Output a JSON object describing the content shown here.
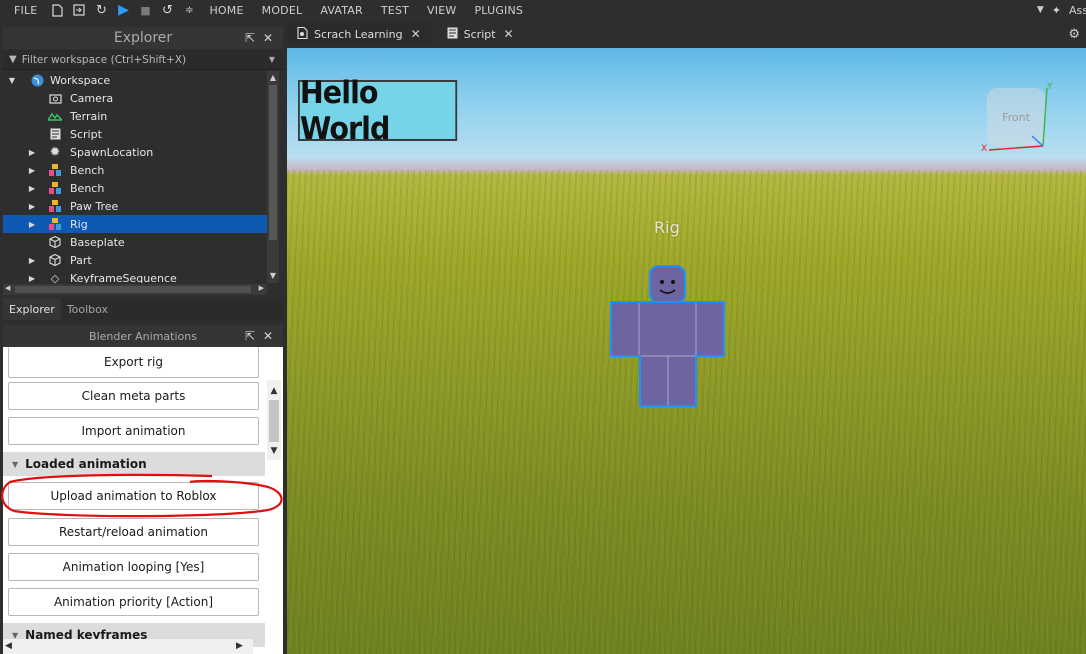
{
  "toolbar": {
    "menus": [
      "FILE",
      "HOME",
      "MODEL",
      "AVATAR",
      "TEST",
      "VIEW",
      "PLUGINS"
    ],
    "right_label": "Ass"
  },
  "explorer": {
    "title": "Explorer",
    "filter_placeholder": "Filter workspace (Ctrl+Shift+X)",
    "items": [
      {
        "label": "Workspace",
        "icon": "globe-icon"
      },
      {
        "label": "Camera",
        "icon": "camera-icon"
      },
      {
        "label": "Terrain",
        "icon": "terrain-icon"
      },
      {
        "label": "Script",
        "icon": "script-icon"
      },
      {
        "label": "SpawnLocation",
        "icon": "spawn-icon"
      },
      {
        "label": "Bench",
        "icon": "model-icon"
      },
      {
        "label": "Bench",
        "icon": "model-icon"
      },
      {
        "label": "Paw Tree",
        "icon": "model-icon"
      },
      {
        "label": "Rig",
        "icon": "model-icon",
        "selected": true
      },
      {
        "label": "Baseplate",
        "icon": "part-icon"
      },
      {
        "label": "Part",
        "icon": "part-icon"
      },
      {
        "label": "KeyframeSequence",
        "icon": "keyframe-icon"
      }
    ],
    "tabs": [
      "Explorer",
      "Toolbox"
    ]
  },
  "blender": {
    "title": "Blender Animations",
    "buttons_top": [
      "Export rig",
      "Clean meta parts",
      "Import animation"
    ],
    "section_loaded": "Loaded animation",
    "buttons_loaded": [
      "Upload animation to Roblox",
      "Restart/reload animation",
      "Animation looping [Yes]",
      "Animation priority [Action]"
    ],
    "section_named": "Named keyframes"
  },
  "viewport_tabs": [
    {
      "label": "Scrach Learning",
      "icon": "place-icon"
    },
    {
      "label": "Script",
      "icon": "script-icon"
    }
  ],
  "viewport": {
    "hello_text": "Hello World",
    "rig_label": "Rig",
    "cube_face": "Front",
    "axis": {
      "x": "X",
      "y": "Y"
    }
  },
  "colors": {
    "selection": "#0e5ab3",
    "play": "#2f9bff",
    "annotation": "#e01010",
    "rig_body": "#6e64a0",
    "rig_outline": "#1e90ff"
  }
}
